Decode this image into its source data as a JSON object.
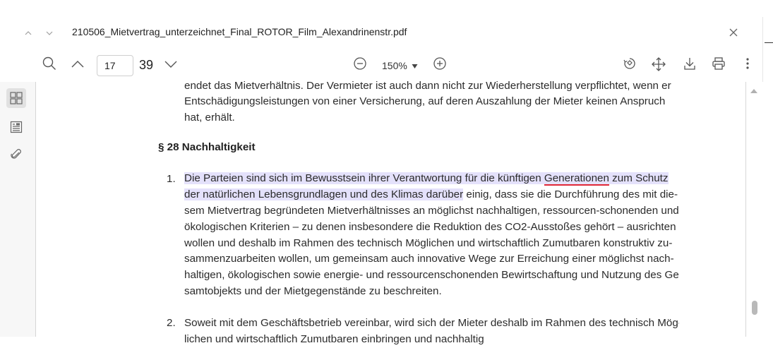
{
  "window": {
    "filename": "210506_Mietvertrag_unterzeichnet_Final_ROTOR_Film_Alexandrinenstr.pdf",
    "prev_doc_icon": "chevron-up-icon",
    "next_doc_icon": "chevron-down-icon",
    "close_icon": "close-icon"
  },
  "toolbar": {
    "search_icon": "search-icon",
    "prev_page_icon": "chevron-up-icon",
    "current_page": "17",
    "total_pages": "39",
    "next_page_icon": "chevron-down-icon",
    "zoom_out_icon": "zoom-out-icon",
    "zoom_level": "150%",
    "zoom_dropdown_icon": "caret-down-icon",
    "zoom_in_icon": "zoom-in-icon",
    "rotate_icon": "rotate-icon",
    "fit_icon": "move-icon",
    "download_icon": "download-icon",
    "print_icon": "print-icon",
    "more_icon": "more-vertical-icon"
  },
  "sidebar": {
    "items": [
      {
        "icon": "thumbnails-icon",
        "active": true
      },
      {
        "icon": "outline-icon",
        "active": false
      },
      {
        "icon": "attachment-icon",
        "active": false
      }
    ]
  },
  "document": {
    "prev_para_lines": [
      "endet das Mietverhältnis. Der Vermieter ist auch dann nicht zur Wiederherstellung verpflichtet, wenn er",
      "Entschädigungsleistungen von einer Versicherung, auf deren Auszahlung der Mieter keinen Anspruch",
      "hat, erhält."
    ],
    "section_heading": "§ 28 Nachhaltigkeit",
    "items": [
      {
        "number": "1.",
        "line1_hl_a": "Die Parteien sind sich ",
        "line1_hl_b": "im Bewusstsein ihrer Verantwortung für die künftigen ",
        "line1_hl_c": "Generationen",
        "line1_hl_d": " zum Schutz",
        "line2_hl": "der natürlichen Lebensgrundlagen und des Klimas darüber",
        "line2_rest": " einig, dass sie die Durchführung des mit die-",
        "lines": [
          "sem Mietvertrag begründeten Mietverhältnisses an möglichst nachhaltigen, ressourcen-schonenden und",
          "ökologischen Kriterien – zu denen insbesondere die Reduktion des CO2-Ausstoßes gehört – ausrichten",
          "wollen und deshalb im Rahmen des technisch Möglichen und wirtschaftlich Zumutbaren konstruktiv zu-",
          "sammenzuarbeiten wollen, um gemeinsam auch innovative Wege zur Erreichung einer möglichst nach-",
          "haltigen, ökologischen sowie energie- und ressourcenschonenden Bewirtschaftung und Nutzung des Ge-",
          "samtobjekts und der Mietgegenstände zu beschreiten."
        ]
      },
      {
        "number": "2.",
        "lines": [
          "Soweit mit dem Geschäftsbetrieb vereinbar, wird sich der Mieter deshalb im Rahmen des technisch Mög-",
          "lichen und wirtschaftlich Zumutbaren einbringen und nachhaltig"
        ]
      }
    ]
  },
  "colors": {
    "highlight": "#988cf0",
    "underline": "#e02838"
  }
}
